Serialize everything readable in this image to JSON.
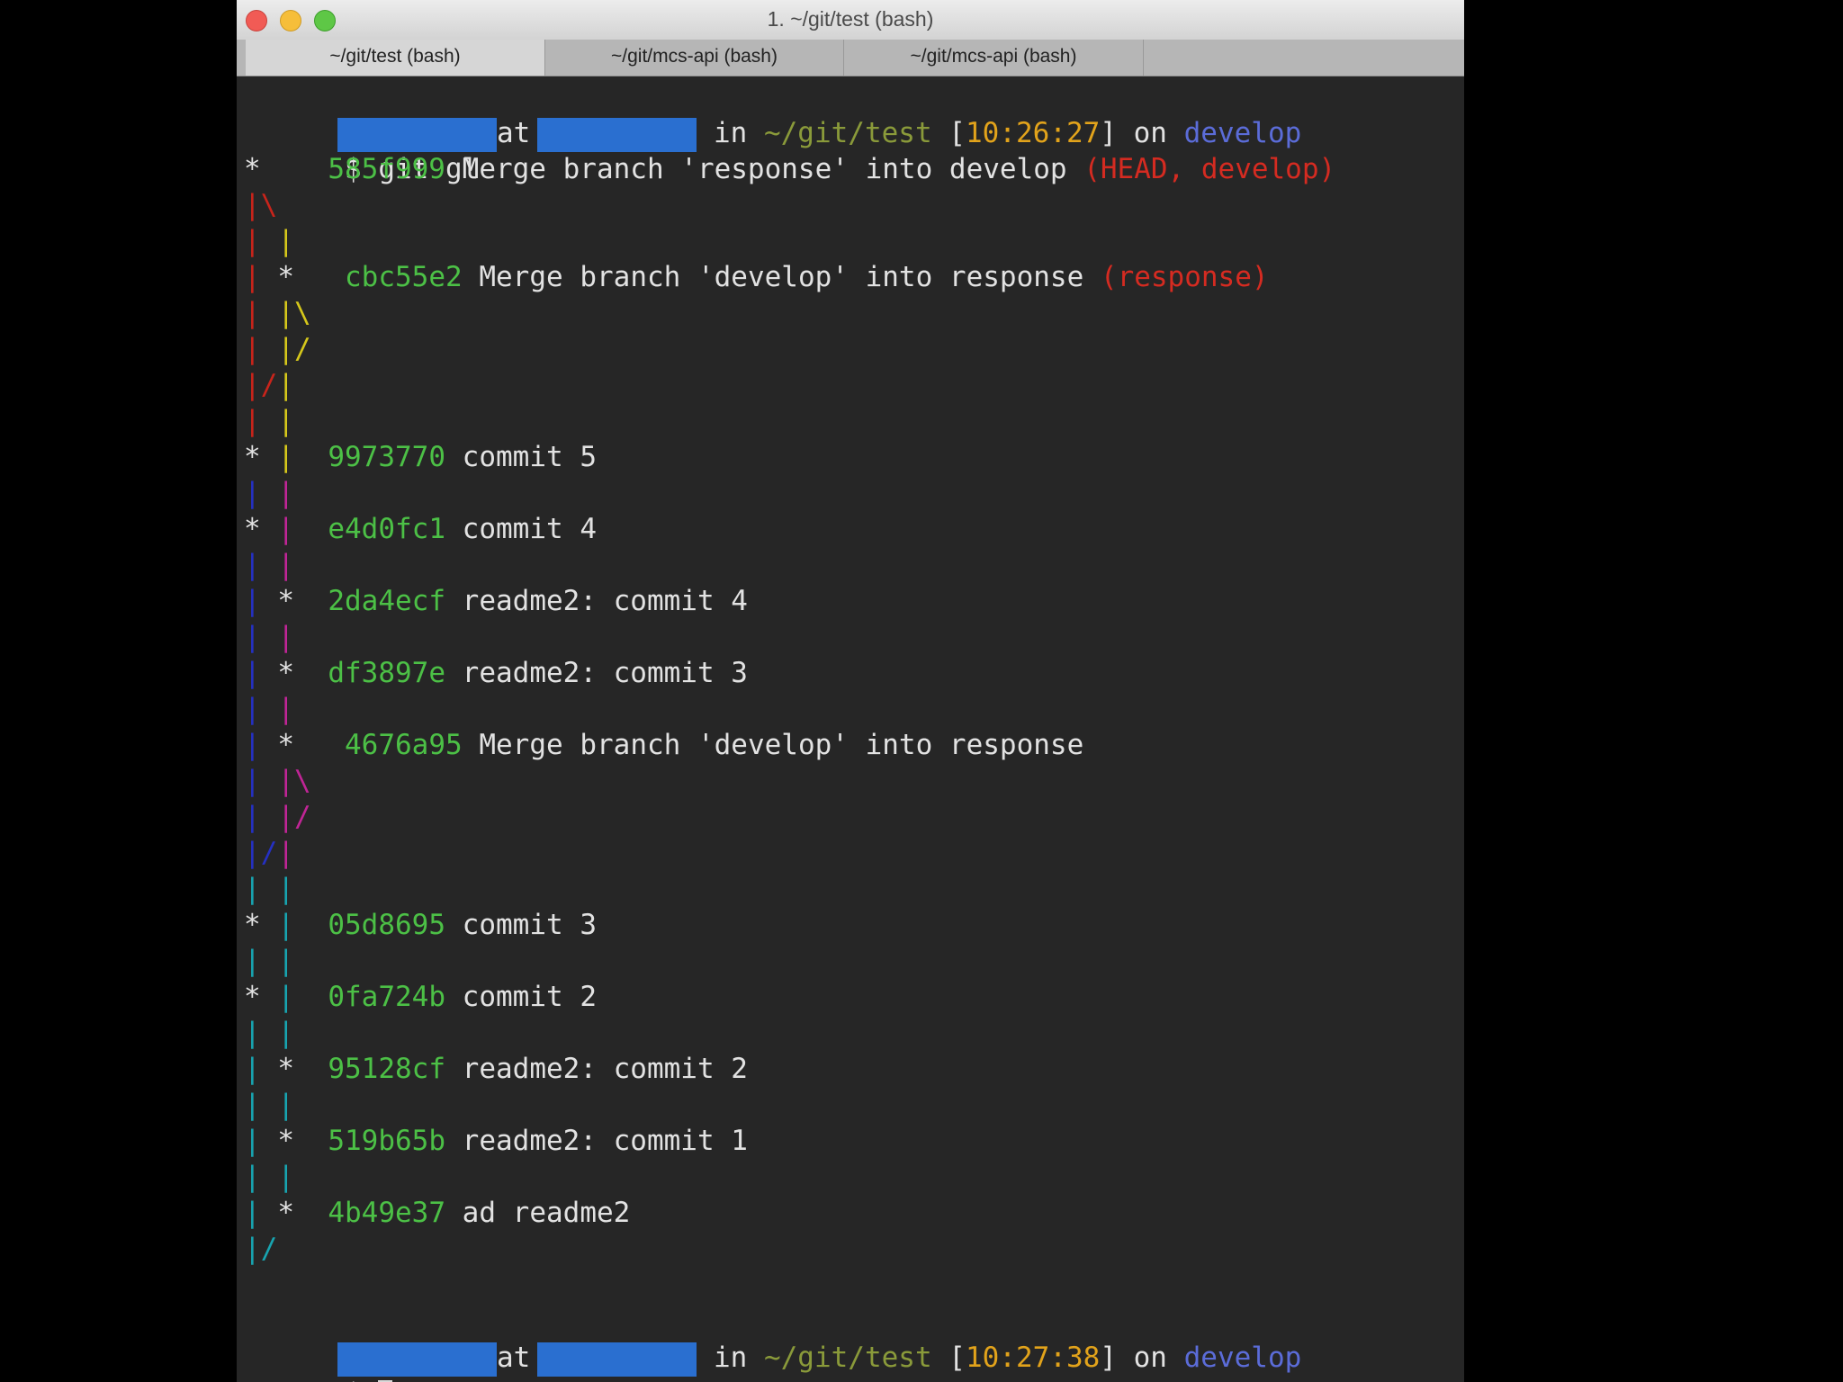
{
  "window": {
    "title": "1. ~/git/test (bash)",
    "tabs": [
      {
        "label": "~/git/test (bash)",
        "active": true
      },
      {
        "label": "~/git/mcs-api (bash)",
        "active": false
      },
      {
        "label": "~/git/mcs-api (bash)",
        "active": false
      }
    ]
  },
  "prompt1": {
    "at": "at",
    "in": "in",
    "path": "~/git/test",
    "bracket_open": "[",
    "time": "10:26:27",
    "bracket_close": "]",
    "on": "on",
    "branch": "develop"
  },
  "command": {
    "symbol": "$",
    "text": "git gl"
  },
  "log": [
    {
      "graph": "*",
      "hash": "585f999",
      "message": "Merge branch 'response' into develop",
      "refs": "(HEAD, develop)"
    },
    {
      "graph": "|\\"
    },
    {
      "graph": "| |"
    },
    {
      "graph": "| *",
      "hash": "cbc55e2",
      "message": "Merge branch 'develop' into response",
      "refs": "(response)"
    },
    {
      "graph": "| |\\"
    },
    {
      "graph": "| |/"
    },
    {
      "graph": "|/|"
    },
    {
      "graph": "| |"
    },
    {
      "graph": "* |",
      "hash": "9973770",
      "message": "commit 5"
    },
    {
      "graph": "| |"
    },
    {
      "graph": "* |",
      "hash": "e4d0fc1",
      "message": "commit 4"
    },
    {
      "graph": "| |"
    },
    {
      "graph": "| *",
      "hash": "2da4ecf",
      "message": "readme2: commit 4"
    },
    {
      "graph": "| |"
    },
    {
      "graph": "| *",
      "hash": "df3897e",
      "message": "readme2: commit 3"
    },
    {
      "graph": "| |"
    },
    {
      "graph": "| *",
      "hash": "4676a95",
      "message": "Merge branch 'develop' into response"
    },
    {
      "graph": "| |\\"
    },
    {
      "graph": "| |/"
    },
    {
      "graph": "|/|"
    },
    {
      "graph": "| |"
    },
    {
      "graph": "* |",
      "hash": "05d8695",
      "message": "commit 3"
    },
    {
      "graph": "| |"
    },
    {
      "graph": "* |",
      "hash": "0fa724b",
      "message": "commit 2"
    },
    {
      "graph": "| |"
    },
    {
      "graph": "| *",
      "hash": "95128cf",
      "message": "readme2: commit 2"
    },
    {
      "graph": "| |"
    },
    {
      "graph": "| *",
      "hash": "519b65b",
      "message": "readme2: commit 1"
    },
    {
      "graph": "| |"
    },
    {
      "graph": "| *",
      "hash": "4b49e37",
      "message": "ad readme2"
    },
    {
      "graph": "|/"
    }
  ],
  "prompt2": {
    "at": "at",
    "in": "in",
    "path": "~/git/test",
    "bracket_open": "[",
    "time": "10:27:38",
    "bracket_close": "]",
    "on": "on",
    "branch": "develop"
  },
  "final_prompt": {
    "symbol": "$"
  },
  "colors": {
    "hash": "#4cc046",
    "refs": "#d52b21",
    "path": "#8a9a3a",
    "time": "#e2a31b",
    "branch": "#5b6cd8",
    "redaction": "#2a6fd0",
    "background": "#262626"
  }
}
